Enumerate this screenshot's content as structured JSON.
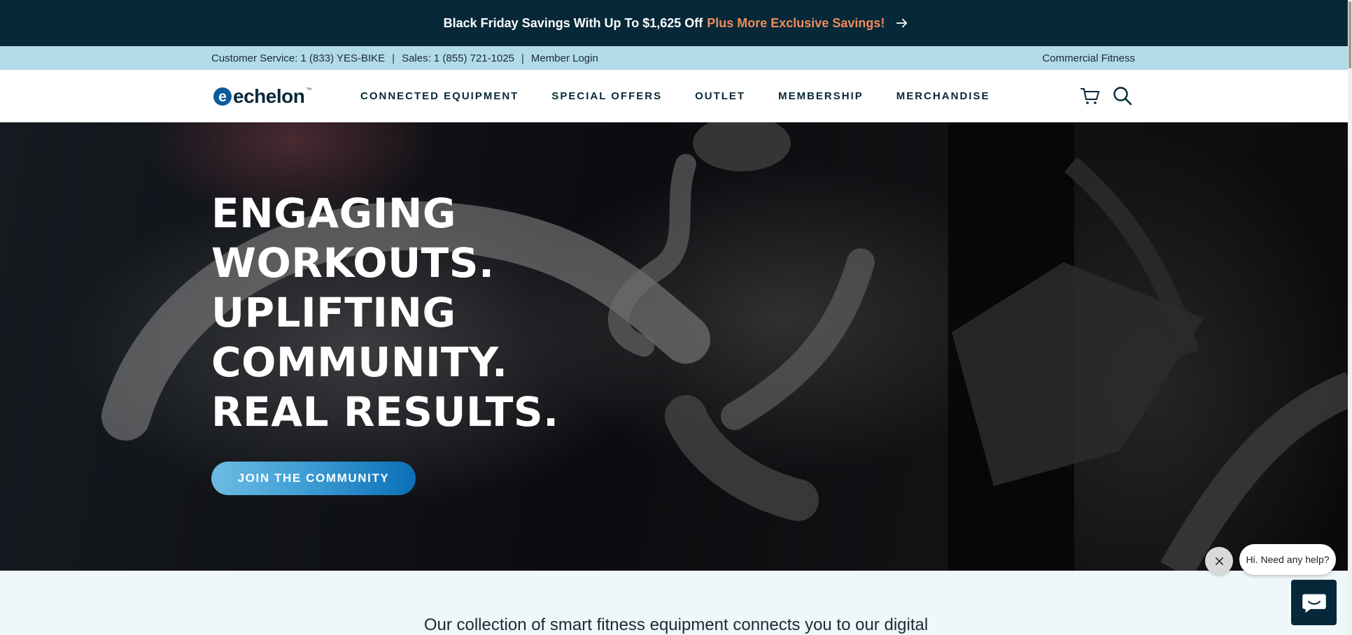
{
  "promo": {
    "text": "Black Friday Savings With Up To $1,625 Off",
    "accent": "Plus More Exclusive Savings!",
    "icon": "arrow-right-icon"
  },
  "utility": {
    "customer_service": "Customer Service: 1 (833) YES-BIKE",
    "sales": "Sales: 1 (855) 721-1025",
    "member_login": "Member Login",
    "commercial": "Commercial Fitness",
    "separator": "|"
  },
  "nav": {
    "logo_text": "echelon",
    "logo_mark": "e",
    "logo_tm": "™",
    "links": [
      "CONNECTED EQUIPMENT",
      "SPECIAL OFFERS",
      "OUTLET",
      "MEMBERSHIP",
      "MERCHANDISE"
    ],
    "icons": [
      "cart-icon",
      "search-icon"
    ]
  },
  "hero": {
    "lines": [
      "ENGAGING",
      "WORKOUTS.",
      "UPLIFTING",
      "COMMUNITY.",
      "REAL RESULTS."
    ],
    "cta": "JOIN THE COMMUNITY"
  },
  "intro": {
    "text": "Our collection of smart fitness equipment connects you to our digital"
  },
  "chat": {
    "prompt": "Hi. Need any help?",
    "close_icon": "close-icon",
    "chat_icon": "chat-icon"
  },
  "colors": {
    "promo_bg": "#062838",
    "promo_accent": "#f08c5a",
    "util_bg": "#b2dbea",
    "navy": "#062838",
    "cta_start": "#6dbbe2",
    "cta_end": "#0a6fb7",
    "intro_bg": "#eef7fa"
  }
}
